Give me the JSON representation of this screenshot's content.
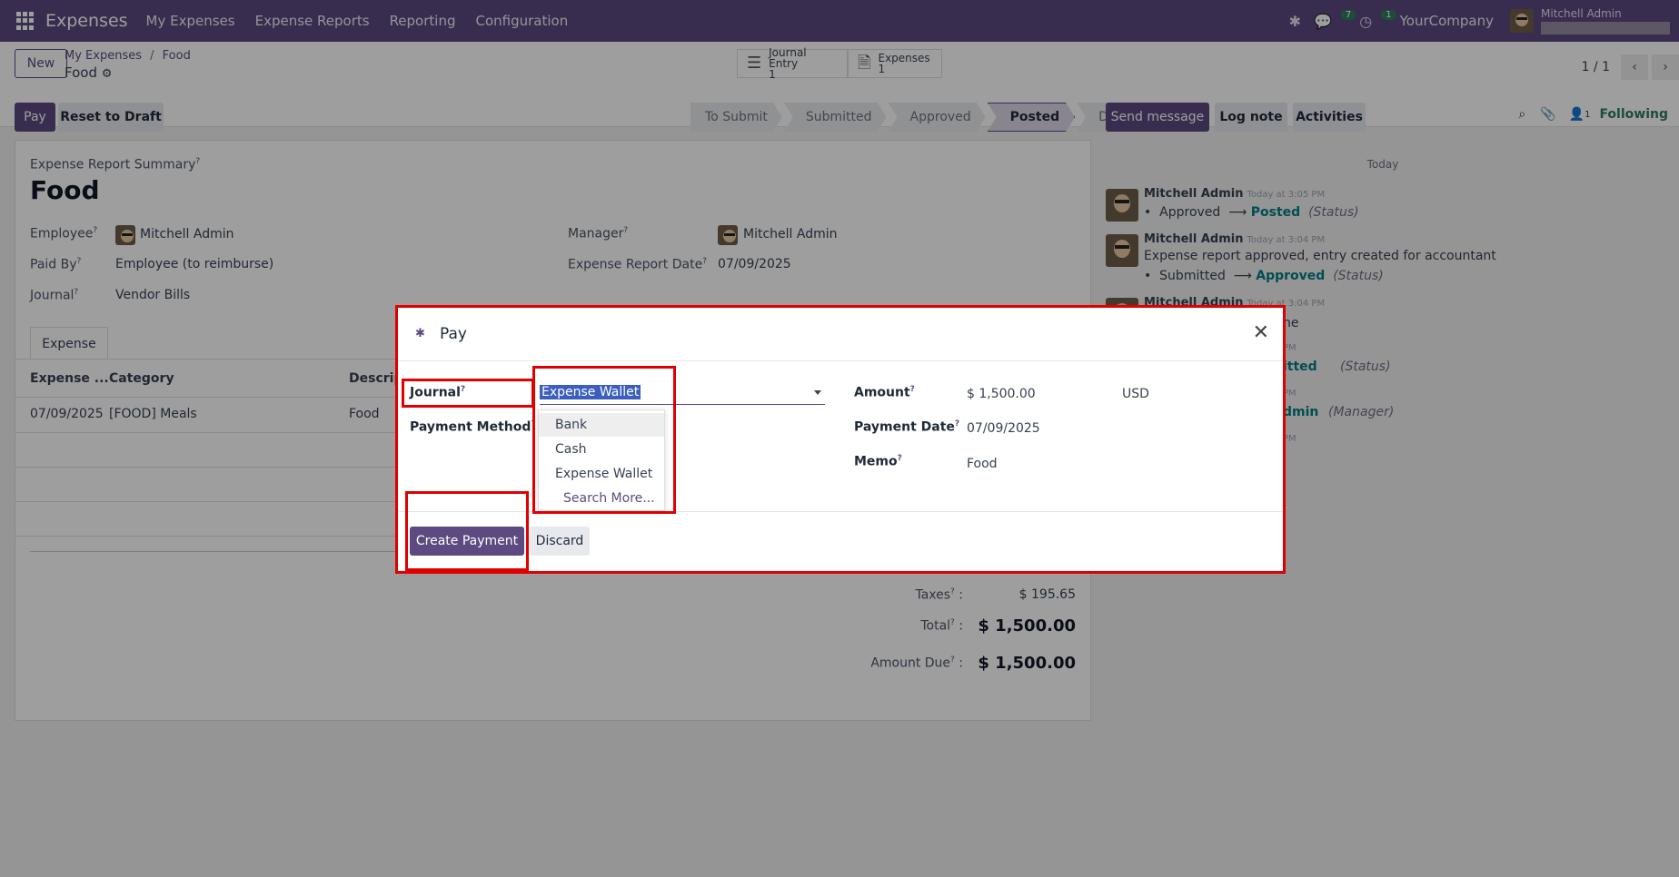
{
  "topbar": {
    "app_name": "Expenses",
    "menu": [
      "My Expenses",
      "Expense Reports",
      "Reporting",
      "Configuration"
    ],
    "messages_count": "7",
    "activities_count": "1",
    "company": "YourCompany",
    "user": "Mitchell Admin"
  },
  "control": {
    "new_label": "New",
    "breadcrumb_parent": "My Expenses",
    "breadcrumb_sep": "/",
    "breadcrumb_current": "Food",
    "record_name": "Food",
    "smart_journal_label": "Journal Entry",
    "smart_journal_count": "1",
    "smart_expenses_label": "Expenses",
    "smart_expenses_count": "1",
    "pager": "1 / 1"
  },
  "actions": {
    "pay": "Pay",
    "reset": "Reset to Draft"
  },
  "stages": [
    "To Submit",
    "Submitted",
    "Approved",
    "Posted",
    "Done"
  ],
  "active_stage": "Posted",
  "chatter_actions": {
    "send": "Send message",
    "log": "Log note",
    "activities": "Activities",
    "followers_count": "1",
    "following": "Following"
  },
  "form": {
    "summary_label": "Expense Report Summary",
    "title": "Food",
    "employee_label": "Employee",
    "employee": "Mitchell Admin",
    "paid_by_label": "Paid By",
    "paid_by": "Employee (to reimburse)",
    "journal_label": "Journal",
    "journal": "Vendor Bills",
    "manager_label": "Manager",
    "manager": "Mitchell Admin",
    "report_date_label": "Expense Report Date",
    "report_date": "07/09/2025",
    "tab": "Expense",
    "columns": [
      "Expense ...",
      "Category",
      "Descrip"
    ],
    "row": [
      "07/09/2025",
      "[FOOD] Meals",
      "Food"
    ],
    "taxes_label": "Taxes",
    "taxes": "$ 195.65",
    "total_label": "Total",
    "total": "$ 1,500.00",
    "amount_due_label": "Amount Due",
    "amount_due": "$ 1,500.00"
  },
  "chatter": {
    "today": "Today",
    "messages": [
      {
        "author": "Mitchell Admin",
        "time": "Today at 3:05 PM",
        "from": "Approved",
        "to": "Posted",
        "field": "(Status)"
      },
      {
        "author": "Mitchell Admin",
        "time": "Today at 3:04 PM",
        "body": "Expense report approved, entry created for accountant",
        "from": "Submitted",
        "to": "Approved",
        "field": "(Status)"
      },
      {
        "author": "Mitchell Admin",
        "time": "Today at 3:04 PM"
      }
    ],
    "partial": [
      "ne",
      "itted",
      "(Status)",
      "dmin",
      "(Manager)",
      "PM",
      "PM",
      "PM",
      "PM"
    ]
  },
  "modal": {
    "title": "Pay",
    "journal_label": "Journal",
    "journal_value": "Expense Wallet",
    "payment_method_label": "Payment Method",
    "dropdown": [
      "Bank",
      "Cash",
      "Expense Wallet"
    ],
    "search_more": "Search More...",
    "amount_label": "Amount",
    "amount": "$ 1,500.00",
    "currency": "USD",
    "payment_date_label": "Payment Date",
    "payment_date": "07/09/2025",
    "memo_label": "Memo",
    "memo": "Food",
    "create_payment": "Create Payment",
    "discard": "Discard"
  },
  "colors": {
    "brand": "#5c4a80",
    "highlight_box": "#e00000",
    "selection": "#3b5ec0",
    "following": "#2e7d5b"
  }
}
